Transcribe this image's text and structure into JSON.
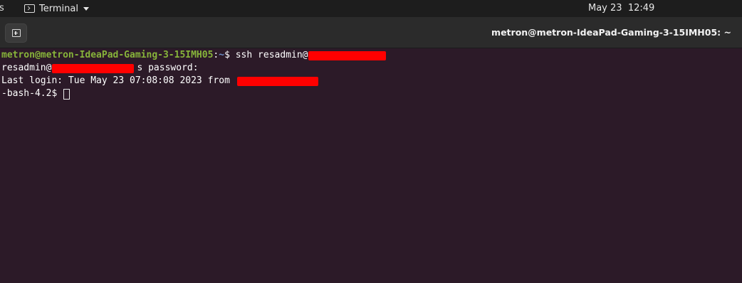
{
  "topbar": {
    "activities_stub": "s",
    "app_menu_label": "Terminal",
    "clock": "May 23  12:49"
  },
  "window": {
    "title": "metron@metron-IdeaPad-Gaming-3-15IMH05: ~"
  },
  "terminal": {
    "prompt_user_host": "metron@metron-IdeaPad-Gaming-3-15IMH05",
    "prompt_sep": ":",
    "prompt_cwd": "~",
    "prompt_symbol": "$ ",
    "command": "ssh resadmin@",
    "password_prefix": "resadmin@",
    "password_suffix": "s password:",
    "last_login": "Last login: Tue May 23 07:08:08 2023 from ",
    "remote_prompt": "-bash-4.2$ "
  },
  "colors": {
    "terminal_bg": "#2c1a28",
    "prompt_user": "#87b43a",
    "prompt_path": "#6b8fc9",
    "redaction": "#ff0000"
  },
  "icons": {
    "app_menu": "terminal-icon",
    "new_tab": "new-tab-icon"
  }
}
